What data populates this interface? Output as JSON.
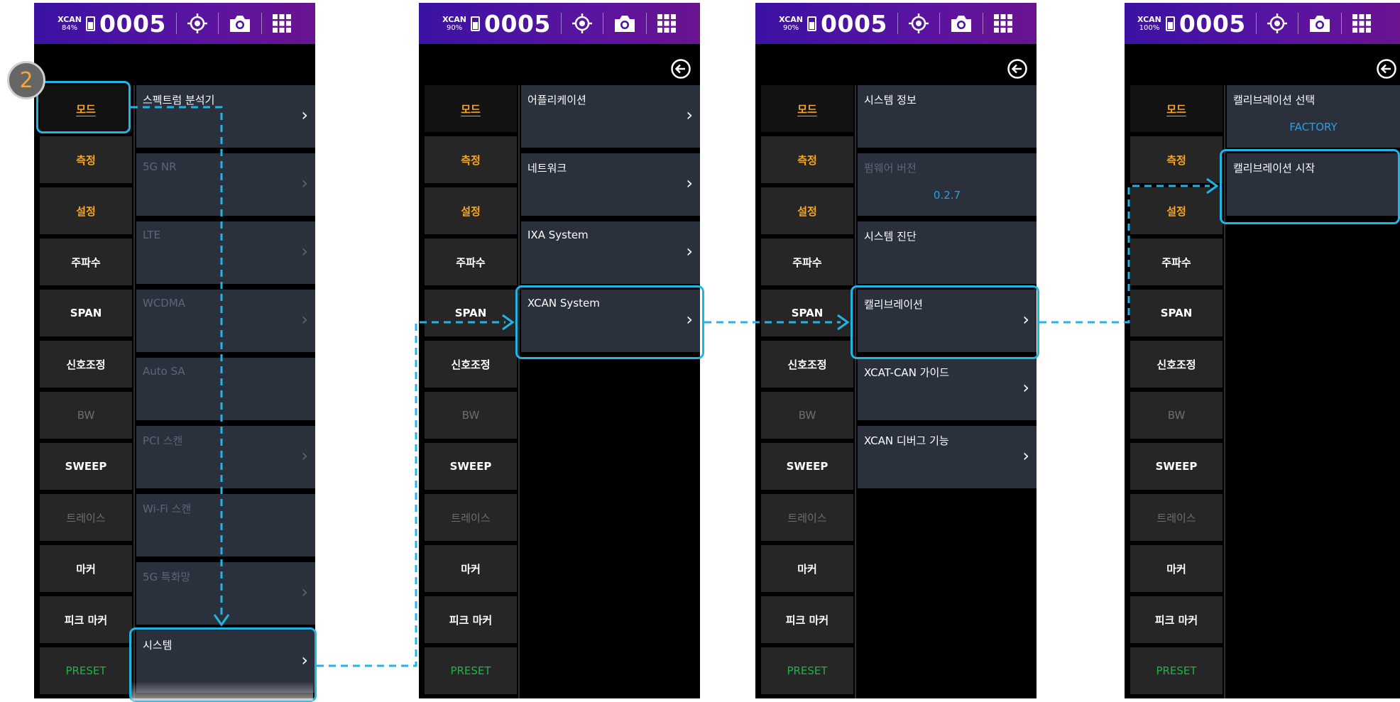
{
  "status_bar": {
    "label": "XCAN",
    "counter": "0005"
  },
  "screens": [
    {
      "battery": "84%",
      "step_number": "2",
      "left_menu": [
        "모드",
        "측정",
        "설정",
        "주파수",
        "SPAN",
        "신호조정",
        "BW",
        "SWEEP",
        "트레이스",
        "마커",
        "피크 마커",
        "PRESET"
      ],
      "items": [
        {
          "label": "스펙트럼 분석기"
        },
        {
          "label": "5G NR"
        },
        {
          "label": "LTE"
        },
        {
          "label": "WCDMA"
        },
        {
          "label": "Auto SA"
        },
        {
          "label": "PCI 스캔"
        },
        {
          "label": "Wi-Fi 스캔"
        },
        {
          "label": "5G 특화망"
        },
        {
          "label": "시스템"
        }
      ]
    },
    {
      "battery": "90%",
      "left_menu": [
        "모드",
        "측정",
        "설정",
        "주파수",
        "SPAN",
        "신호조정",
        "BW",
        "SWEEP",
        "트레이스",
        "마커",
        "피크 마커",
        "PRESET"
      ],
      "items": [
        {
          "label": "어플리케이션"
        },
        {
          "label": "네트워크"
        },
        {
          "label": "IXA System"
        },
        {
          "label": "XCAN System"
        }
      ]
    },
    {
      "battery": "90%",
      "left_menu": [
        "모드",
        "측정",
        "설정",
        "주파수",
        "SPAN",
        "신호조정",
        "BW",
        "SWEEP",
        "트레이스",
        "마커",
        "피크 마커",
        "PRESET"
      ],
      "items": [
        {
          "label": "시스템 정보"
        },
        {
          "label": "펌웨어 버전",
          "value": "0.2.7"
        },
        {
          "label": "시스템 진단"
        },
        {
          "label": "캘리브레이션"
        },
        {
          "label": "XCAT-CAN 가이드"
        },
        {
          "label": "XCAN 디버그 기능"
        }
      ]
    },
    {
      "battery": "100%",
      "left_menu": [
        "모드",
        "측정",
        "설정",
        "주파수",
        "SPAN",
        "신호조정",
        "BW",
        "SWEEP",
        "트레이스",
        "마커",
        "피크 마커",
        "PRESET"
      ],
      "items": [
        {
          "label": "캘리브레이션 선택",
          "value": "FACTORY"
        },
        {
          "label": "캘리브레이션 시작"
        }
      ]
    }
  ],
  "colors": {
    "accent_highlight": "#21b5e6",
    "status_bar": "#4a14a0",
    "menu_orange": "#f5a623",
    "menu_green": "#21b24b",
    "value_blue": "#2b9fe0",
    "submenu_bg": "#2b303d"
  },
  "icons": [
    "battery-icon",
    "crosshair-icon",
    "camera-icon",
    "grid-icon",
    "back-arrow-icon",
    "chevron-right-icon"
  ]
}
